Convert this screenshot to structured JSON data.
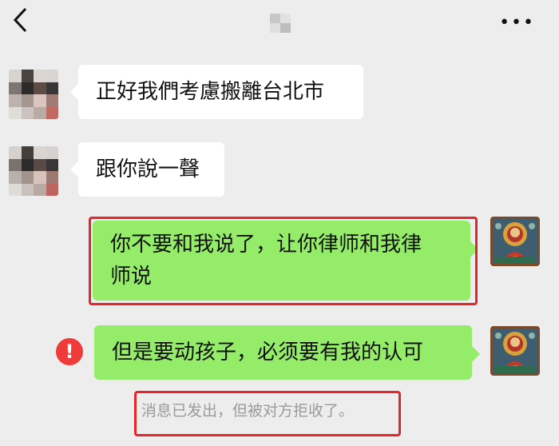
{
  "header": {
    "back_icon": "chevron-left-icon",
    "more_icon": "more-dots-icon",
    "more_glyph": "•••"
  },
  "messages": [
    {
      "side": "left",
      "text": "正好我們考慮搬離台北市"
    },
    {
      "side": "left",
      "text": "跟你說一聲"
    },
    {
      "side": "right",
      "line1": "你不要和我说了，让你律师和我律",
      "line2": "师说",
      "highlighted": true
    },
    {
      "side": "right",
      "text": "但是要动孩子，必须要有我的认可",
      "status": "failed"
    }
  ],
  "error_icon": {
    "glyph": "!",
    "name": "exclamation-icon",
    "color": "#f03b3b"
  },
  "system_notice": "消息已发出，但被对方拒收了。",
  "colors": {
    "background": "#ededed",
    "incoming_bubble": "#ffffff",
    "outgoing_bubble": "#95ec69",
    "highlight_border": "#e3262b",
    "notice_text": "#9a9a9a"
  }
}
